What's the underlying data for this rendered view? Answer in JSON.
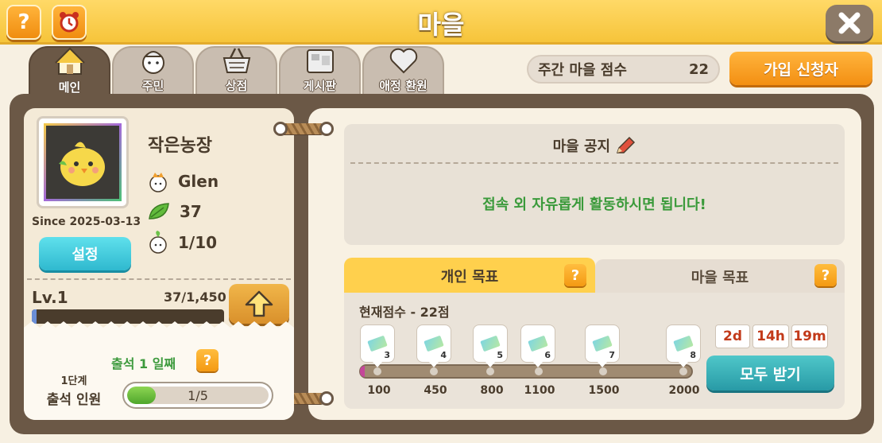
{
  "title": "마을",
  "tabs": [
    {
      "label": "메인",
      "icon": "house-icon",
      "active": true
    },
    {
      "label": "주민",
      "icon": "resident-icon",
      "active": false
    },
    {
      "label": "상점",
      "icon": "basket-icon",
      "active": false
    },
    {
      "label": "게시판",
      "icon": "board-icon",
      "active": false
    },
    {
      "label": "애정 환원",
      "icon": "heart-icon",
      "active": false
    }
  ],
  "weekly_score": {
    "label": "주간 마을 점수",
    "value": "22"
  },
  "join_button": "가입 신청자",
  "village": {
    "name": "작은농장",
    "leader": "Glen",
    "leaves": "37",
    "members": "1/10",
    "since": "Since 2025-03-13",
    "settings_button": "설정",
    "level": "Lv.1",
    "exp_text": "37/1,450",
    "exp_fraction": 0.0255
  },
  "attendance": {
    "text": "출석 1 일째",
    "stage": "1단계",
    "label": "출석 인원",
    "count": "1/5",
    "fraction": 0.2
  },
  "notice": {
    "title": "마을 공지",
    "body": "접속 외 자유롭게 활동하시면 됩니다!"
  },
  "goals": {
    "tab_personal": "개인 목표",
    "tab_village": "마을 목표",
    "current_score": "현재점수 - 22점",
    "milestones": [
      {
        "num": "3",
        "score": "100"
      },
      {
        "num": "4",
        "score": "450"
      },
      {
        "num": "5",
        "score": "800"
      },
      {
        "num": "6",
        "score": "1100"
      },
      {
        "num": "7",
        "score": "1500"
      },
      {
        "num": "8",
        "score": "2000"
      }
    ],
    "timer": {
      "days": "2d",
      "hours": "14h",
      "minutes": "19m"
    },
    "claim_button": "모두 받기"
  },
  "colors": {
    "accent": "#f6c43a",
    "board": "#6b5846",
    "notice_text": "#3a9a3a",
    "timer": "#c23a1a"
  }
}
